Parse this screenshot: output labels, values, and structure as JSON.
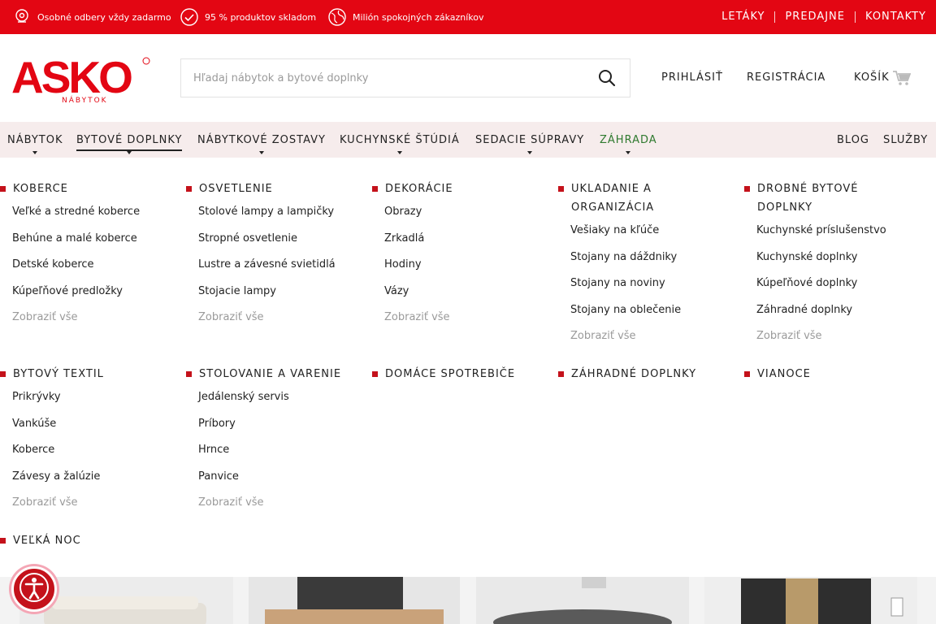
{
  "topbar": {
    "perks": [
      {
        "icon": "pin-icon",
        "text": "Osobné odbery vždy zadarmo"
      },
      {
        "icon": "check-circle-icon",
        "text": "95 % produktov skladom"
      },
      {
        "icon": "globe-icon",
        "text": "Milión spokojných zákazníkov"
      }
    ],
    "links": [
      "LETÁKY",
      "PREDAJNE",
      "KONTAKTY"
    ]
  },
  "header": {
    "logo_text": "ASKO",
    "logo_sub": "NÁBYTOK",
    "search_placeholder": "Hľadaj nábytok a bytové doplnky",
    "login": "PRIHLÁSIŤ",
    "register": "REGISTRÁCIA",
    "cart": "KOŠÍK"
  },
  "nav": {
    "items": [
      "NÁBYTOK",
      "BYTOVÉ DOPLNKY",
      "NÁBYTKOVÉ ZOSTAVY",
      "KUCHYNSKÉ ŠTÚDIÁ",
      "SEDACIE SÚPRAVY",
      "ZÁHRADA"
    ],
    "right": [
      "BLOG",
      "SLUŽBY"
    ],
    "active": "BYTOVÉ DOPLNKY"
  },
  "mega": {
    "columns": [
      {
        "title": "KOBERCE",
        "items": [
          "Veľké a stredné koberce",
          "Behúne a malé koberce",
          "Detské koberce",
          "Kúpeľňové predložky"
        ],
        "all": "Zobraziť vše"
      },
      {
        "title": "OSVETLENIE",
        "items": [
          "Stolové lampy a lampičky",
          "Stropné osvetlenie",
          "Lustre a závesné svietidlá",
          "Stojacie lampy"
        ],
        "all": "Zobraziť vše"
      },
      {
        "title": "DEKORÁCIE",
        "items": [
          "Obrazy",
          "Zrkadlá",
          "Hodiny",
          "Vázy"
        ],
        "all": "Zobraziť vše"
      },
      {
        "title": "UKLADANIE A ORGANIZÁCIA",
        "items": [
          "Vešiaky na kľúče",
          "Stojany na dáždniky",
          "Stojany na noviny",
          "Stojany na oblečenie"
        ],
        "all": "Zobraziť vše"
      },
      {
        "title": "DROBNÉ BYTOVÉ DOPLNKY",
        "items": [
          "Kuchynské príslušenstvo",
          "Kuchynské doplnky",
          "Kúpeľňové doplnky",
          "Záhradné doplnky"
        ],
        "all": "Zobraziť vše"
      },
      {
        "title": "BYTOVÝ TEXTIL",
        "items": [
          "Prikrývky",
          "Vankúše",
          "Koberce",
          "Závesy a žalúzie"
        ],
        "all": "Zobraziť vše"
      },
      {
        "title": "STOLOVANIE A VARENIE",
        "items": [
          "Jedálenský servis",
          "Príbory",
          "Hrnce",
          "Panvice"
        ],
        "all": "Zobraziť vše"
      },
      {
        "title": "DOMÁCE SPOTREBIČE",
        "items": [],
        "all": ""
      },
      {
        "title": "ZÁHRADNÉ DOPLNKY",
        "items": [],
        "all": ""
      },
      {
        "title": "VIANOCE",
        "items": [],
        "all": ""
      },
      {
        "title": "VEĽKÁ NOC",
        "items": [],
        "all": ""
      }
    ]
  },
  "colors": {
    "brand_red": "#e30613",
    "nav_bg": "#f6ecec",
    "bullet": "#c4121b",
    "green": "#2f7a2f"
  }
}
